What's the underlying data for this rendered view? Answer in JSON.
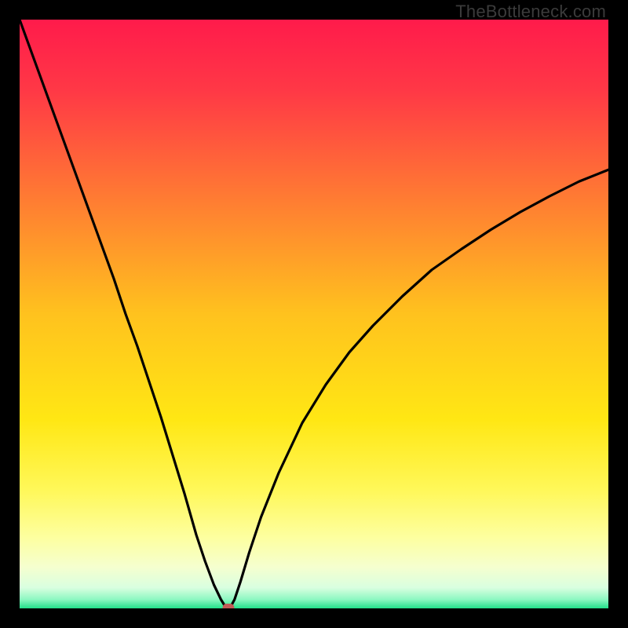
{
  "watermark": "TheBottleneck.com",
  "chart_data": {
    "type": "line",
    "title": "",
    "xlabel": "",
    "ylabel": "",
    "xlim": [
      0,
      100
    ],
    "ylim": [
      0,
      100
    ],
    "gradient_stops": [
      {
        "offset": 0,
        "color": "#ff1b4b"
      },
      {
        "offset": 0.12,
        "color": "#ff3846"
      },
      {
        "offset": 0.3,
        "color": "#ff7a33"
      },
      {
        "offset": 0.5,
        "color": "#ffc21e"
      },
      {
        "offset": 0.68,
        "color": "#ffe714"
      },
      {
        "offset": 0.8,
        "color": "#fff85a"
      },
      {
        "offset": 0.88,
        "color": "#fdffa0"
      },
      {
        "offset": 0.93,
        "color": "#f5ffcf"
      },
      {
        "offset": 0.965,
        "color": "#d9ffe0"
      },
      {
        "offset": 0.985,
        "color": "#8cf7c1"
      },
      {
        "offset": 1.0,
        "color": "#22e08a"
      }
    ],
    "series": [
      {
        "name": "bottleneck-curve",
        "color": "#000000",
        "x": [
          0.0,
          2.0,
          4.0,
          6.0,
          8.0,
          10.0,
          12.0,
          14.0,
          16.0,
          18.0,
          20.0,
          22.0,
          24.0,
          26.0,
          28.0,
          30.0,
          31.5,
          33.0,
          34.2,
          35.0,
          35.8,
          36.5,
          37.5,
          39.0,
          41.0,
          44.0,
          48.0,
          52.0,
          56.0,
          60.0,
          65.0,
          70.0,
          75.0,
          80.0,
          85.0,
          90.0,
          95.0,
          100.0
        ],
        "values": [
          100,
          94.5,
          89.0,
          83.5,
          78.0,
          72.5,
          67.0,
          61.5,
          56.0,
          50.0,
          44.5,
          38.5,
          32.5,
          26.0,
          19.5,
          12.5,
          8.0,
          4.0,
          1.5,
          0.2,
          0.2,
          1.5,
          4.5,
          9.5,
          15.5,
          23.0,
          31.5,
          38.0,
          43.5,
          48.0,
          53.0,
          57.5,
          61.0,
          64.3,
          67.3,
          70.0,
          72.5,
          74.5
        ]
      }
    ],
    "min_point": {
      "x": 35.4,
      "y": 0
    }
  }
}
